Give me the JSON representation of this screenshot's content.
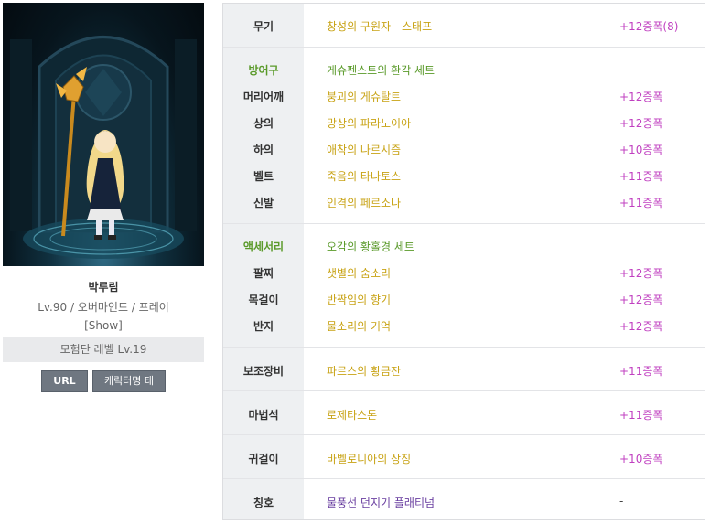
{
  "profile": {
    "name": "박루림",
    "info": "Lv.90 / 오버마인드 / 프레이",
    "show": "[Show]",
    "adventure_level": "모험단 레벨 Lv.19",
    "url_button": "URL",
    "tag_button": "캐릭터명 태그"
  },
  "equipment": {
    "weapon": {
      "slot": "무기",
      "item": "창성의 구원자 - 스태프",
      "enh": "+12증폭(8)"
    },
    "armor": {
      "slot": "방어구",
      "set": "게슈펜스트의 환각 세트",
      "items": [
        {
          "slot": "머리어깨",
          "item": "붕괴의 게슈탈트",
          "enh": "+12증폭"
        },
        {
          "slot": "상의",
          "item": "망상의 파라노이아",
          "enh": "+12증폭"
        },
        {
          "slot": "하의",
          "item": "애착의 나르시즘",
          "enh": "+10증폭"
        },
        {
          "slot": "벨트",
          "item": "죽음의 타나토스",
          "enh": "+11증폭"
        },
        {
          "slot": "신발",
          "item": "인격의 페르소나",
          "enh": "+11증폭"
        }
      ]
    },
    "accessory": {
      "slot": "액세서리",
      "set": "오감의 황홀경 세트",
      "items": [
        {
          "slot": "팔찌",
          "item": "샛별의 숨소리",
          "enh": "+12증폭"
        },
        {
          "slot": "목걸이",
          "item": "반짝임의 향기",
          "enh": "+12증폭"
        },
        {
          "slot": "반지",
          "item": "물소리의 기억",
          "enh": "+12증폭"
        }
      ]
    },
    "sub": {
      "slot": "보조장비",
      "item": "파르스의 황금잔",
      "enh": "+11증폭"
    },
    "magic": {
      "slot": "마법석",
      "item": "로제타스톤",
      "enh": "+11증폭"
    },
    "earring": {
      "slot": "귀걸이",
      "item": "바벨로니아의 상징",
      "enh": "+10증폭"
    },
    "title": {
      "slot": "칭호",
      "item": "물풍선 던지기 플래티넘",
      "enh": "-"
    }
  }
}
